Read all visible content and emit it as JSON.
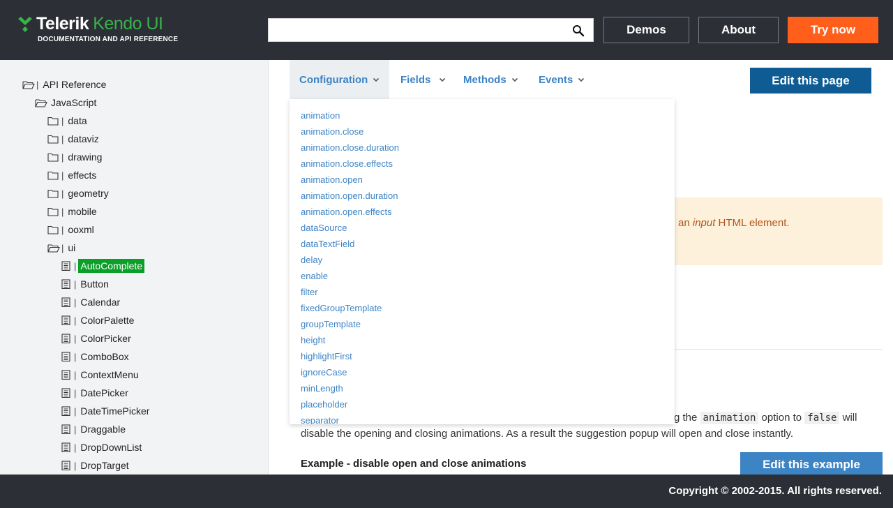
{
  "header": {
    "brand": "Telerik",
    "product": "Kendo UI",
    "subtitle": "DOCUMENTATION AND API REFERENCE",
    "search_value": "",
    "demos_label": "Demos",
    "about_label": "About",
    "try_label": "Try now",
    "accent_color": "#37b34a",
    "try_color": "#ff5f1a"
  },
  "sidebar": {
    "items": [
      {
        "label": "API Reference",
        "icon": "folder-open-icon"
      },
      {
        "label": "JavaScript",
        "icon": "folder-open-icon"
      },
      {
        "label": "data",
        "icon": "folder-icon"
      },
      {
        "label": "dataviz",
        "icon": "folder-icon"
      },
      {
        "label": "drawing",
        "icon": "folder-icon"
      },
      {
        "label": "effects",
        "icon": "folder-icon"
      },
      {
        "label": "geometry",
        "icon": "folder-icon"
      },
      {
        "label": "mobile",
        "icon": "folder-icon"
      },
      {
        "label": "ooxml",
        "icon": "folder-icon"
      },
      {
        "label": "ui",
        "icon": "folder-open-icon"
      },
      {
        "label": "AutoComplete",
        "icon": "document-icon",
        "selected": true
      },
      {
        "label": "Button",
        "icon": "document-icon"
      },
      {
        "label": "Calendar",
        "icon": "document-icon"
      },
      {
        "label": "ColorPalette",
        "icon": "document-icon"
      },
      {
        "label": "ColorPicker",
        "icon": "document-icon"
      },
      {
        "label": "ComboBox",
        "icon": "document-icon"
      },
      {
        "label": "ContextMenu",
        "icon": "document-icon"
      },
      {
        "label": "DatePicker",
        "icon": "document-icon"
      },
      {
        "label": "DateTimePicker",
        "icon": "document-icon"
      },
      {
        "label": "Draggable",
        "icon": "document-icon"
      },
      {
        "label": "DropDownList",
        "icon": "document-icon"
      },
      {
        "label": "DropTarget",
        "icon": "document-icon"
      }
    ],
    "selected_color": "#0a9f26"
  },
  "tabs": [
    {
      "label": "Configuration",
      "active": true
    },
    {
      "label": "Fields"
    },
    {
      "label": "Methods"
    },
    {
      "label": "Events"
    }
  ],
  "edit_page_label": "Edit this page",
  "config_menu": [
    "animation",
    "animation.close",
    "animation.close.duration",
    "animation.close.effects",
    "animation.open",
    "animation.open.duration",
    "animation.open.effects",
    "dataSource",
    "dataTextField",
    "delay",
    "enable",
    "filter",
    "fixedGroupTemplate",
    "groupTemplate",
    "height",
    "highlightFirst",
    "ignoreCase",
    "minLength",
    "placeholder",
    "separator"
  ],
  "notice": {
    "prefix": "an ",
    "emph": "input",
    "suffix": " HTML element."
  },
  "content": {
    "line1_pre": "g the ",
    "line1_code1": "animation",
    "line1_mid": " option to ",
    "line1_code2": "false",
    "line1_post": " will",
    "line2": "disable the opening and closing animations. As a result the suggestion popup will open and close instantly.",
    "example_title": "Example - disable open and close animations",
    "edit_example_label": "Edit this example"
  },
  "footer": {
    "copyright": "Copyright © 2002-2015. All rights reserved."
  }
}
